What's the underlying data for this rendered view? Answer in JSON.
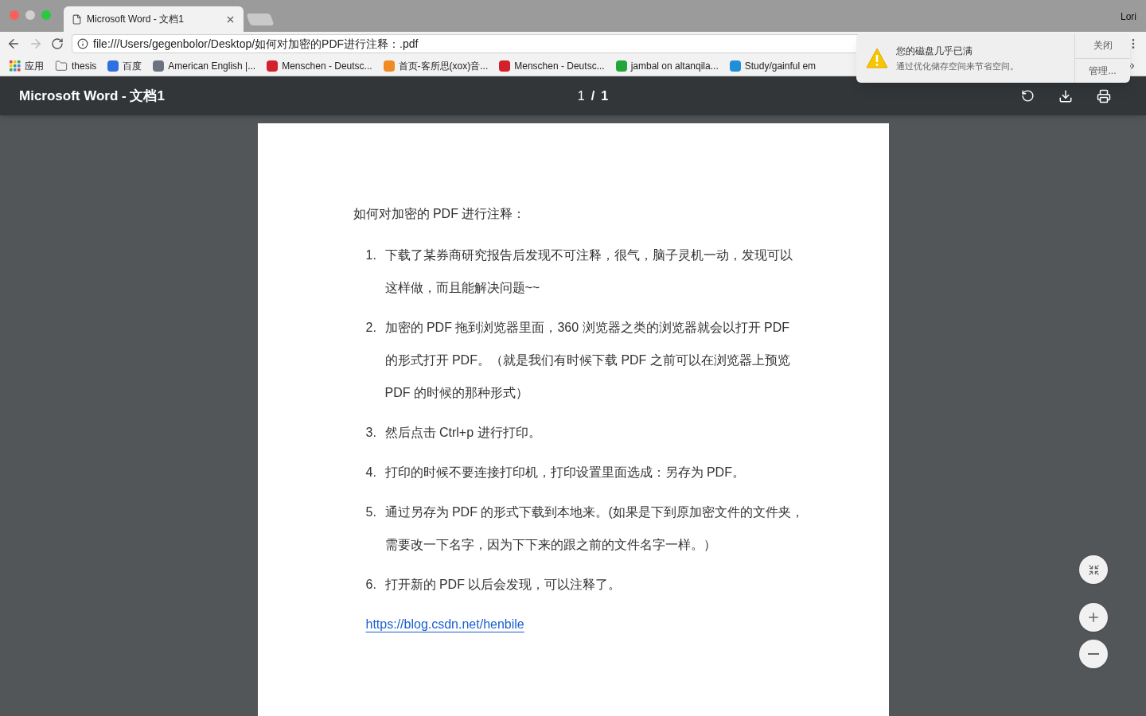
{
  "window": {
    "tab_title": "Microsoft Word - 文档1",
    "user": "Lori"
  },
  "address": "file:///Users/gegenbolor/Desktop/如何对加密的PDF进行注释：.pdf",
  "bookmarks": [
    {
      "label": "应用",
      "kind": "apps"
    },
    {
      "label": "thesis",
      "kind": "folder"
    },
    {
      "label": "百度",
      "kind": "site",
      "color": "#2f6fe0"
    },
    {
      "label": "American English |...",
      "kind": "site",
      "color": "#6b7280"
    },
    {
      "label": "Menschen - Deutsc...",
      "kind": "site",
      "color": "#d3202a"
    },
    {
      "label": "首页-客所思(xox)音...",
      "kind": "site",
      "color": "#f08a24"
    },
    {
      "label": "Menschen - Deutsc...",
      "kind": "site",
      "color": "#d3202a"
    },
    {
      "label": "jambal on altanqila...",
      "kind": "site",
      "color": "#22a53a"
    },
    {
      "label": "Study/gainful em",
      "kind": "site",
      "color": "#1f8fd8"
    }
  ],
  "notification": {
    "title": "您的磁盘几乎已满",
    "message": "通过优化储存空间来节省空间。",
    "buttons": [
      "关闭",
      "管理..."
    ]
  },
  "pdf_toolbar": {
    "title": "Microsoft Word - 文档1",
    "page_current": "1",
    "page_separator": "/",
    "page_total": "1"
  },
  "document": {
    "heading": "如何对加密的 PDF 进行注释：",
    "items": [
      {
        "number": "1.",
        "lines": [
          "下载了某券商研究报告后发现不可注释，很气，脑子灵机一动，发现可以",
          "这样做，而且能解决问题~~"
        ]
      },
      {
        "number": "2.",
        "lines": [
          "加密的 PDF 拖到浏览器里面，360 浏览器之类的浏览器就会以打开 PDF",
          "的形式打开 PDF。（就是我们有时候下载 PDF 之前可以在浏览器上预览",
          "PDF 的时候的那种形式）"
        ]
      },
      {
        "number": "3.",
        "lines": [
          "然后点击 Ctrl+p 进行打印。"
        ]
      },
      {
        "number": "4.",
        "lines": [
          "打印的时候不要连接打印机，打印设置里面选成：另存为 PDF。"
        ]
      },
      {
        "number": "5.",
        "lines": [
          "通过另存为 PDF 的形式下载到本地来。(如果是下到原加密文件的文件夹，",
          "需要改一下名字，因为下下来的跟之前的文件名字一样。）"
        ]
      },
      {
        "number": "6.",
        "lines": [
          "打开新的 PDF 以后会发现，可以注释了。"
        ]
      }
    ],
    "link": "https://blog.csdn.net/henbile"
  }
}
